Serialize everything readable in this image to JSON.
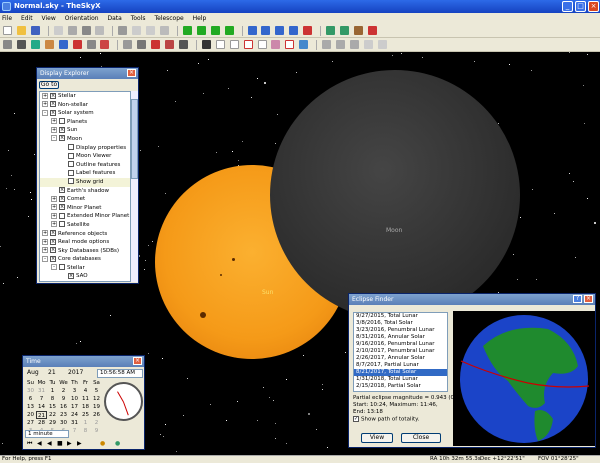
{
  "window": {
    "title": "Normal.sky - TheSkyX"
  },
  "menu": [
    "File",
    "Edit",
    "View",
    "Orientation",
    "Data",
    "Tools",
    "Telescope",
    "Help"
  ],
  "sky": {
    "sun_label": "Sun",
    "moon_label": "Moon"
  },
  "display_explorer": {
    "title": "Display Explorer",
    "go_to": "Go to",
    "items": [
      {
        "label": "Stellar",
        "indent": 0,
        "exp": "+",
        "chk": "x"
      },
      {
        "label": "Non-stellar",
        "indent": 0,
        "exp": "+",
        "chk": "x"
      },
      {
        "label": "Solar system",
        "indent": 0,
        "exp": "-",
        "chk": "x"
      },
      {
        "label": "Planets",
        "indent": 1,
        "exp": "+",
        "chk": ""
      },
      {
        "label": "Sun",
        "indent": 1,
        "exp": "+",
        "chk": "x"
      },
      {
        "label": "Moon",
        "indent": 1,
        "exp": "-",
        "chk": "x"
      },
      {
        "label": "Display properties",
        "indent": 2,
        "exp": "",
        "chk": ""
      },
      {
        "label": "Moon Viewer",
        "indent": 2,
        "exp": "",
        "chk": ""
      },
      {
        "label": "Outline features",
        "indent": 2,
        "exp": "",
        "chk": ""
      },
      {
        "label": "Label features",
        "indent": 2,
        "exp": "",
        "chk": ""
      },
      {
        "label": "Show grid",
        "indent": 2,
        "exp": "",
        "chk": "",
        "selected": true
      },
      {
        "label": "Earth's shadow",
        "indent": 1,
        "exp": "",
        "chk": "x"
      },
      {
        "label": "Comet",
        "indent": 1,
        "exp": "+",
        "chk": "x"
      },
      {
        "label": "Minor Planet",
        "indent": 1,
        "exp": "+",
        "chk": "x"
      },
      {
        "label": "Extended Minor Planet",
        "indent": 1,
        "exp": "+",
        "chk": ""
      },
      {
        "label": "Satellite",
        "indent": 1,
        "exp": "+",
        "chk": ""
      },
      {
        "label": "Reference objects",
        "indent": 0,
        "exp": "+",
        "chk": "x"
      },
      {
        "label": "Real mode options",
        "indent": 0,
        "exp": "+",
        "chk": "x"
      },
      {
        "label": "Sky Databases (SDBs)",
        "indent": 0,
        "exp": "+",
        "chk": "x"
      },
      {
        "label": "Core databases",
        "indent": 0,
        "exp": "-",
        "chk": "x"
      },
      {
        "label": "Stellar",
        "indent": 1,
        "exp": "-",
        "chk": ""
      },
      {
        "label": "SAO",
        "indent": 2,
        "exp": "",
        "chk": "x"
      },
      {
        "label": "Hipparcos/Tycho",
        "indent": 2,
        "exp": "",
        "chk": "x"
      },
      {
        "label": "USNO B (subset)",
        "indent": 2,
        "exp": "",
        "chk": ""
      }
    ]
  },
  "time_panel": {
    "title": "Time",
    "month": "Aug",
    "day": "21",
    "year": "2017",
    "time": "10:56:58 AM",
    "weekdays": [
      "Su",
      "Mo",
      "Tu",
      "We",
      "Th",
      "Fr",
      "Sa"
    ],
    "dates": [
      [
        "30",
        "31",
        "1",
        "2",
        "3",
        "4",
        "5"
      ],
      [
        "6",
        "7",
        "8",
        "9",
        "10",
        "11",
        "12"
      ],
      [
        "13",
        "14",
        "15",
        "16",
        "17",
        "18",
        "19"
      ],
      [
        "20",
        "21",
        "22",
        "23",
        "24",
        "25",
        "26"
      ],
      [
        "27",
        "28",
        "29",
        "30",
        "31",
        "1",
        "2"
      ],
      [
        "3",
        "4",
        "5",
        "6",
        "7",
        "8",
        "9"
      ]
    ],
    "step": "1 minute"
  },
  "eclipse_finder": {
    "title": "Eclipse Finder",
    "eclipses": [
      "9/27/2015, Total Lunar",
      "3/8/2016, Total Solar",
      "3/23/2016, Penumbral Lunar",
      "8/31/2016, Annular Solar",
      "9/16/2016, Penumbral Lunar",
      "2/10/2017, Penumbral Lunar",
      "2/26/2017, Annular Solar",
      "8/7/2017, Partial Lunar",
      "8/21/2017, Total Solar",
      "1/31/2018, Total Lunar",
      "2/15/2018, Partial Solar"
    ],
    "selected_index": 8,
    "magnitude_text": "Partial eclipse magnitude = 0.943 (0.94).",
    "times_text": "Start: 10:24, Maximum: 11:46,",
    "end_text": "End: 13:18",
    "show_path_label": "Show path of totality.",
    "view_button": "View",
    "close_button": "Close"
  },
  "status": {
    "help": "For Help, press F1",
    "ra": "RA 10h 32m 55.3s",
    "dec": "Dec +12°22'51\"",
    "fov": "FOV 01°28'25\""
  },
  "colors": {
    "sun": "#f59a18",
    "moon": "#2c2c2c",
    "title_blue": "#1542c0",
    "ocean": "#1b44c8",
    "land": "#1f8a2e"
  }
}
